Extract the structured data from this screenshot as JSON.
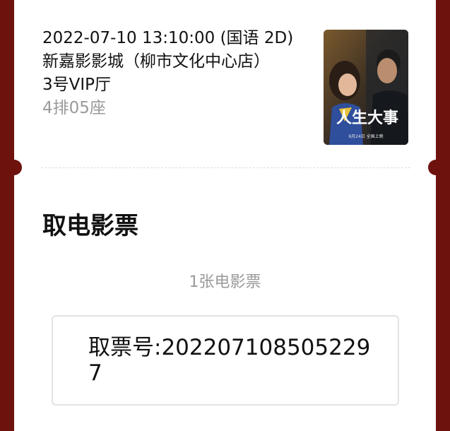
{
  "show": {
    "datetime": "2022-07-10 13:10:00 (国语 2D)",
    "cinema": "新嘉影影城（柳市文化中心店）",
    "hall": "3号VIP厅",
    "seat": "4排05座"
  },
  "poster": {
    "title_art": "人生大事",
    "release_note": "6月24日 全国上映"
  },
  "pickup": {
    "section_title": "取电影票",
    "ticket_count": "1张电影票",
    "code_label": "取票号:2022071085052297"
  },
  "colors": {
    "frame": "#6e120d",
    "card": "#ffffff",
    "muted_text": "#9a9a9a"
  }
}
